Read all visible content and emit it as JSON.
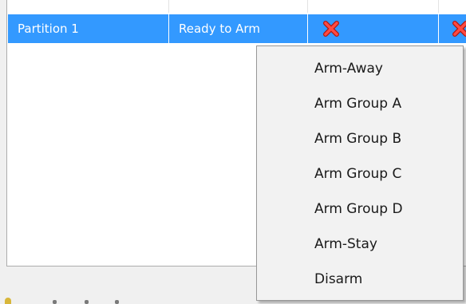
{
  "partition_list": {
    "row": {
      "name": "Partition 1",
      "status": "Ready to Arm",
      "cells": [
        {
          "icon": "red-x-icon"
        },
        {
          "icon": "red-x-icon"
        }
      ]
    },
    "selected_color": "#3399ff",
    "icon_color": "#e8362e"
  },
  "context_menu": {
    "items": [
      {
        "label": "Arm-Away"
      },
      {
        "label": "Arm Group A"
      },
      {
        "label": "Arm Group B"
      },
      {
        "label": "Arm Group C"
      },
      {
        "label": "Arm Group D"
      },
      {
        "label": "Arm-Stay"
      },
      {
        "label": "Disarm"
      }
    ]
  }
}
